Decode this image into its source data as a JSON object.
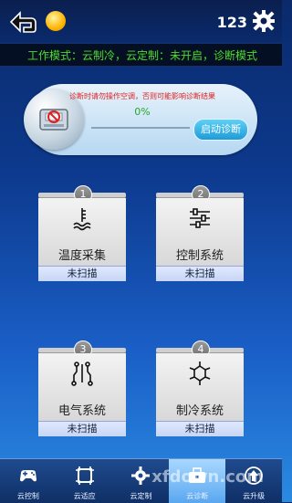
{
  "topbar": {
    "code": "123"
  },
  "marquee": {
    "text": "工作模式：云制冷，云定制：未开启，诊断模式"
  },
  "diagnosis": {
    "warning": "诊断时请勿操作空调，否则可能影响诊断结果",
    "progress": "0%",
    "progress_fraction": 0,
    "start_label": "启动诊断"
  },
  "modules": [
    {
      "num": "1",
      "name": "温度采集",
      "status": "未扫描",
      "icon": "thermometer-icon"
    },
    {
      "num": "2",
      "name": "控制系统",
      "status": "未扫描",
      "icon": "sliders-icon"
    },
    {
      "num": "3",
      "name": "电气系统",
      "status": "未扫描",
      "icon": "circuit-icon"
    },
    {
      "num": "4",
      "name": "制冷系统",
      "status": "未扫描",
      "icon": "snowflake-icon"
    }
  ],
  "navbar": {
    "items": [
      {
        "label": "云控制",
        "icon": "gamepad-icon"
      },
      {
        "label": "云适应",
        "icon": "frame-icon"
      },
      {
        "label": "云定制",
        "icon": "gear-icon"
      },
      {
        "label": "云诊断",
        "icon": "toolbox-icon"
      },
      {
        "label": "云升级",
        "icon": "upgrade-icon"
      }
    ],
    "active_index": 3
  },
  "watermark": {
    "text": "xfdown.com"
  },
  "colors": {
    "marquee_text": "#4ddc2a",
    "warning_text": "#e02020",
    "progress_text": "#2aa52a",
    "accent": "#1d9bd8"
  }
}
